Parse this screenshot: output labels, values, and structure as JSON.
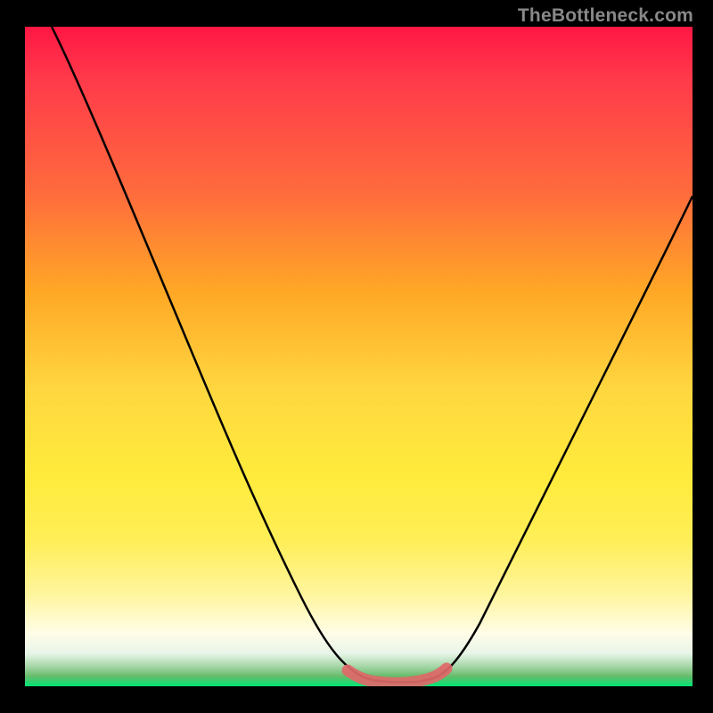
{
  "watermark": "TheBottleneck.com",
  "chart_data": {
    "type": "line",
    "title": "",
    "xlabel": "",
    "ylabel": "",
    "xlim": [
      0,
      100
    ],
    "ylim": [
      0,
      100
    ],
    "series": [
      {
        "name": "curve",
        "x": [
          4,
          10,
          18,
          26,
          34,
          42,
          48,
          52,
          55,
          58,
          60,
          62,
          66,
          72,
          80,
          88,
          96,
          100
        ],
        "y": [
          100,
          88,
          72,
          56,
          40,
          24,
          10,
          2,
          0,
          0,
          0,
          1,
          8,
          20,
          36,
          52,
          68,
          76
        ]
      },
      {
        "name": "bottom-marker",
        "x": [
          48,
          50,
          52,
          54,
          56,
          58,
          60,
          62
        ],
        "y": [
          2.5,
          1.2,
          0.5,
          0.3,
          0.3,
          0.4,
          0.8,
          2.2
        ]
      }
    ],
    "colors": {
      "curve": "#000000",
      "marker": "#e57373",
      "gradient_top": "#ff1744",
      "gradient_mid": "#ffd740",
      "gradient_bottom": "#00e676"
    }
  }
}
